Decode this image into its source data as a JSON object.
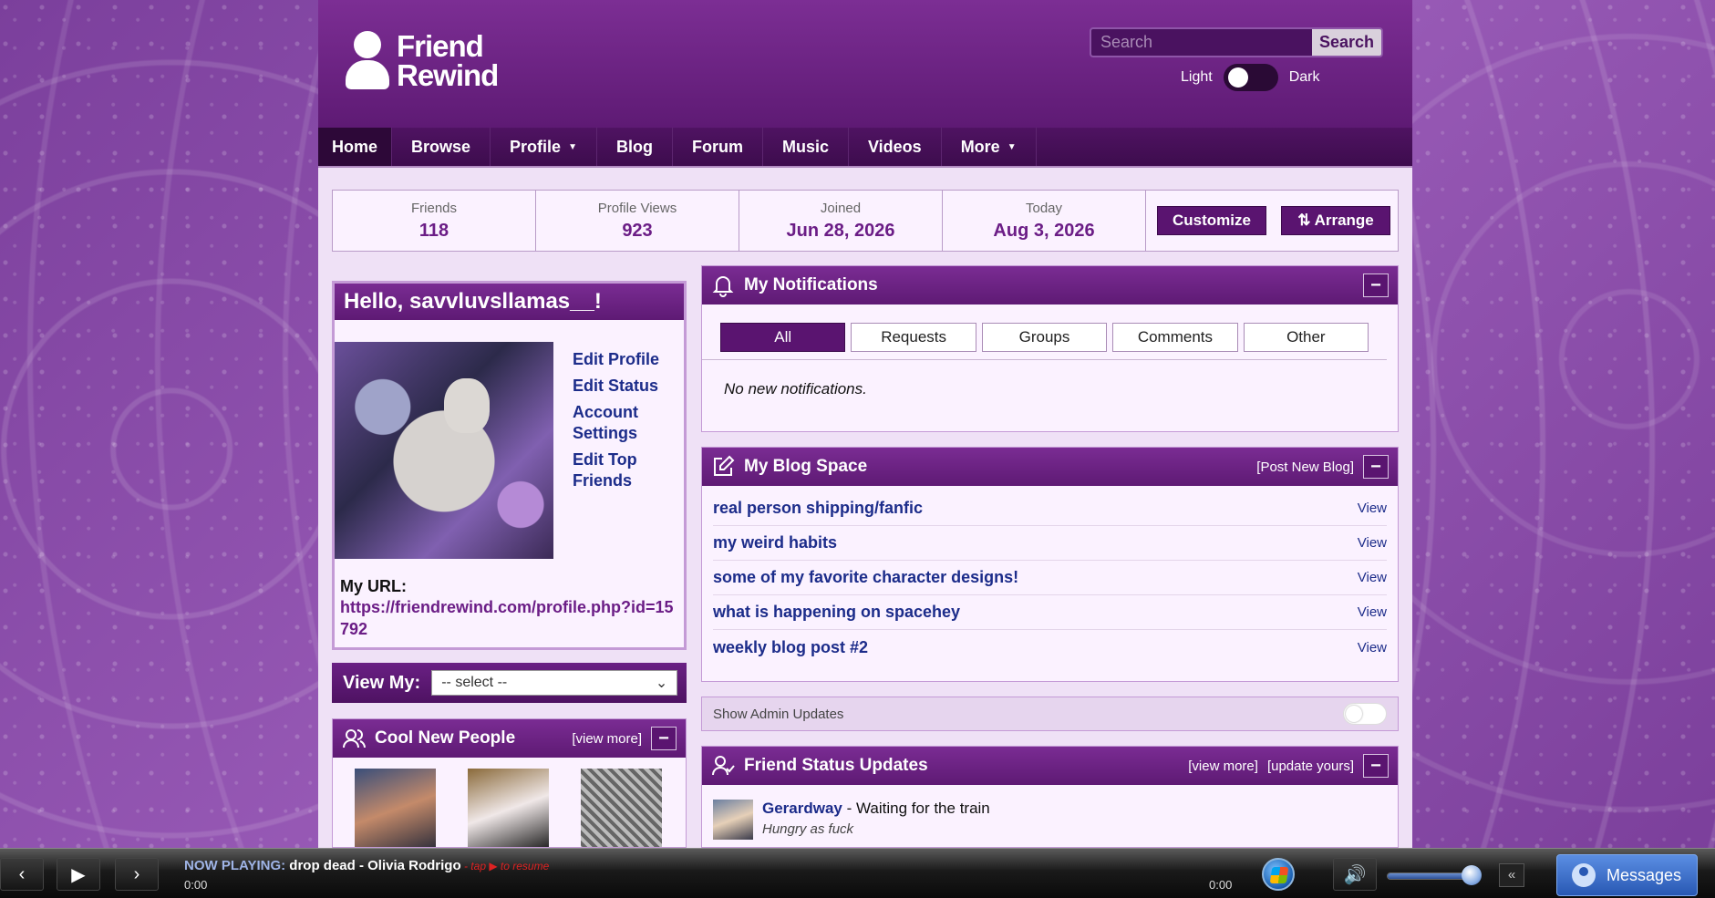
{
  "brand": {
    "line1": "Friend",
    "line2": "Rewind"
  },
  "search": {
    "placeholder": "Search",
    "button": "Search"
  },
  "theme": {
    "light": "Light",
    "dark": "Dark"
  },
  "nav": [
    {
      "label": "Home",
      "caret": ""
    },
    {
      "label": "Browse",
      "caret": ""
    },
    {
      "label": "Profile",
      "caret": "▼"
    },
    {
      "label": "Blog",
      "caret": ""
    },
    {
      "label": "Forum",
      "caret": ""
    },
    {
      "label": "Music",
      "caret": ""
    },
    {
      "label": "Videos",
      "caret": ""
    },
    {
      "label": "More",
      "caret": "▼"
    }
  ],
  "stats": [
    {
      "label": "Friends",
      "value": "118"
    },
    {
      "label": "Profile Views",
      "value": "923"
    },
    {
      "label": "Joined",
      "value": "Jun 28, 2026"
    },
    {
      "label": "Today",
      "value": "Aug 3, 2026"
    }
  ],
  "buttons": {
    "customize": "Customize",
    "arrange": "⇅ Arrange"
  },
  "hello": {
    "title": "Hello, savvluvsllamas__!",
    "links": [
      "Edit Profile",
      "Edit Status",
      "Account Settings",
      "Edit Top Friends"
    ],
    "url_label": "My URL:",
    "url": "https://friendrewind.com/profile.php?id=15792"
  },
  "view_my": {
    "label": "View My:",
    "selected": "-- select --"
  },
  "cool_people": {
    "title": "Cool New People",
    "view_more": "[view more]",
    "minimize": "−"
  },
  "notifications": {
    "title": "My Notifications",
    "tabs": [
      "All",
      "Requests",
      "Groups",
      "Comments",
      "Other"
    ],
    "empty": "No new notifications.",
    "minimize": "−"
  },
  "blog": {
    "title": "My Blog Space",
    "post_new": "[Post New Blog]",
    "minimize": "−",
    "posts": [
      {
        "title": "real person shipping/fanfic",
        "view": "View"
      },
      {
        "title": "my weird habits",
        "view": "View"
      },
      {
        "title": "some of my favorite character designs!",
        "view": "View"
      },
      {
        "title": "what is happening on spacehey",
        "view": "View"
      },
      {
        "title": "weekly blog post #2",
        "view": "View"
      }
    ]
  },
  "admin_updates": {
    "label": "Show Admin Updates"
  },
  "friend_status": {
    "title": "Friend Status Updates",
    "view_more": "[view more]",
    "update_yours": "[update yours]",
    "minimize": "−",
    "items": [
      {
        "name": "Gerardway",
        "text": " - Waiting for the train",
        "sub": "Hungry as fuck"
      }
    ]
  },
  "player": {
    "now_playing_label": "NOW PLAYING:",
    "track": " drop dead - Olivia Rodrigo",
    "hint": " - tap ▶ to resume",
    "time_start": "0:00",
    "time_end": "0:00",
    "collapse": "«",
    "messages": "Messages",
    "volume": 0.88
  },
  "colors": {
    "brand_purple": "#5a1470",
    "link_blue": "#1c2c8a",
    "accent_purple": "#6b1d86"
  }
}
